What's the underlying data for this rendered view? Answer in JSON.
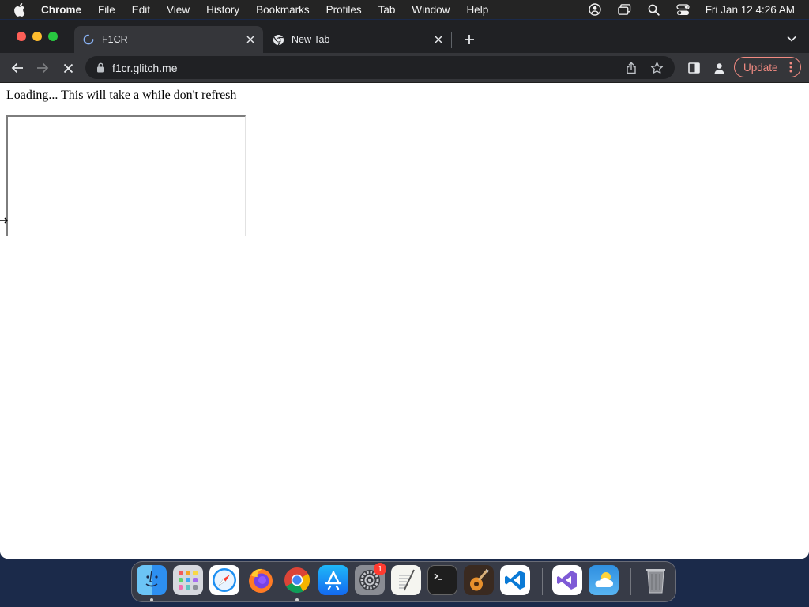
{
  "menubar": {
    "app_name": "Chrome",
    "menus": [
      "File",
      "Edit",
      "View",
      "History",
      "Bookmarks",
      "Profiles",
      "Tab",
      "Window",
      "Help"
    ],
    "status_icons": [
      "user-account-icon",
      "screen-mirroring-icon",
      "spotlight-search-icon",
      "control-center-icon"
    ],
    "clock": "Fri Jan 12  4:26 AM"
  },
  "browser": {
    "tabs": [
      {
        "title": "F1CR",
        "icon": "loading-spinner-icon",
        "active": true
      },
      {
        "title": "New Tab",
        "icon": "chrome-icon",
        "active": false
      }
    ],
    "address_bar": {
      "url": "f1cr.glitch.me",
      "secure_icon": "lock-icon"
    },
    "toolbar_icons": [
      "back-arrow-icon",
      "forward-arrow-icon",
      "stop-loading-icon",
      "share-icon",
      "bookmark-star-icon",
      "side-panel-icon",
      "profile-icon"
    ],
    "update_button": {
      "label": "Update"
    },
    "colors": {
      "tabstrip": "#202124",
      "toolbar": "#35363a",
      "update_accent": "#f28b82"
    }
  },
  "page": {
    "loading_message": "Loading... This will take a while don't refresh"
  },
  "dock": {
    "apps": [
      {
        "name": "Finder",
        "running": true
      },
      {
        "name": "Launchpad",
        "running": false
      },
      {
        "name": "Safari",
        "running": false
      },
      {
        "name": "Firefox",
        "running": false
      },
      {
        "name": "Google Chrome",
        "running": true
      },
      {
        "name": "App Store",
        "running": false
      },
      {
        "name": "System Settings",
        "running": false,
        "badge": "1"
      },
      {
        "name": "TextEdit",
        "running": false
      },
      {
        "name": "Terminal",
        "running": false
      },
      {
        "name": "GarageBand",
        "running": false
      },
      {
        "name": "Visual Studio Code",
        "running": false
      },
      {
        "name": "Visual Studio",
        "running": false
      },
      {
        "name": "Weather",
        "running": false
      },
      {
        "name": "Trash",
        "running": false
      }
    ]
  }
}
